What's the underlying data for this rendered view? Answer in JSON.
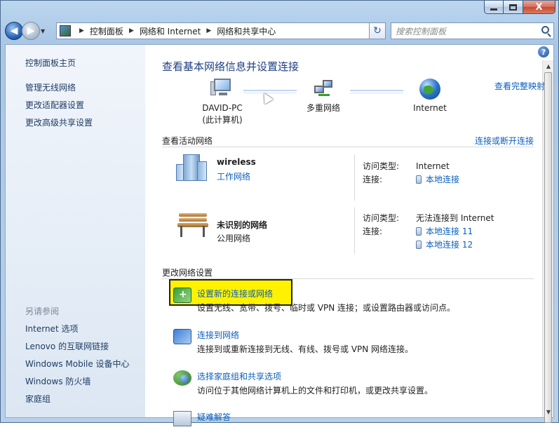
{
  "window": {
    "minimize_label": "–",
    "maximize_label": "",
    "close_label": "X"
  },
  "nav": {
    "back": "◀",
    "forward": "▶",
    "breadcrumbs": [
      "控制面板",
      "网络和 Internet",
      "网络和共享中心"
    ],
    "search_placeholder": "搜索控制面板",
    "refresh": "↻"
  },
  "sidebar": {
    "home": "控制面板主页",
    "items": [
      "管理无线网络",
      "更改适配器设置",
      "更改高级共享设置"
    ],
    "see_also_title": "另请参阅",
    "see_also": [
      "Internet 选项",
      "Lenovo 的互联网链接",
      "Windows Mobile 设备中心",
      "Windows 防火墙",
      "家庭组"
    ]
  },
  "main": {
    "help": "?",
    "title": "查看基本网络信息并设置连接",
    "full_map_link": "查看完整映射",
    "map": {
      "computer_name": "DAVID-PC",
      "computer_sub": "(此计算机)",
      "network": "多重网络",
      "internet": "Internet"
    },
    "active_header": "查看活动网络",
    "connect_disconnect": "连接或断开连接",
    "networks": [
      {
        "name": "wireless",
        "type": "工作网络",
        "access_label": "访问类型:",
        "access_value": "Internet",
        "conn_label": "连接:",
        "connections": [
          "本地连接"
        ]
      },
      {
        "name": "未识别的网络",
        "type": "公用网络",
        "access_label": "访问类型:",
        "access_value": "无法连接到 Internet",
        "conn_label": "连接:",
        "connections": [
          "本地连接 11",
          "本地连接 12"
        ]
      }
    ],
    "change_header": "更改网络设置",
    "tasks": [
      {
        "title": "设置新的连接或网络",
        "desc": "设置无线、宽带、拨号、临时或 VPN 连接；或设置路由器或访问点。"
      },
      {
        "title": "连接到网络",
        "desc": "连接到或重新连接到无线、有线、拨号或 VPN 网络连接。"
      },
      {
        "title": "选择家庭组和共享选项",
        "desc": "访问位于其他网络计算机上的文件和打印机，或更改共享设置。"
      },
      {
        "title": "疑难解答",
        "desc": ""
      }
    ]
  }
}
